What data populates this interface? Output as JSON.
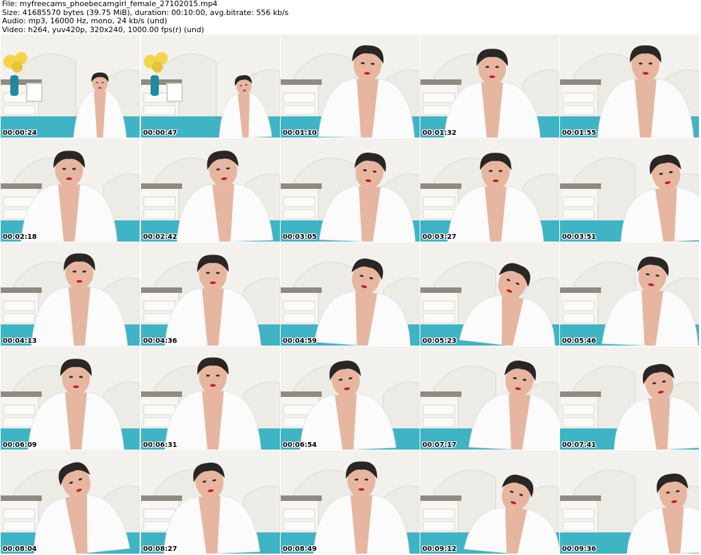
{
  "header": {
    "file_line": "File: myfreecams_phoebecamgirl_female_27102015.mp4",
    "size_line": "Size: 41685570 bytes (39.75 MiB), duration: 00:10:00, avg.bitrate: 556 kb/s",
    "audio_line": "Audio: mp3, 16000 Hz, mono, 24 kb/s (und)",
    "video_line": "Video: h264, yuv420p, 320x240, 1000.00 fps(r) (und)"
  },
  "thumbnails": [
    {
      "timestamp": "00:00:24"
    },
    {
      "timestamp": "00:00:47"
    },
    {
      "timestamp": "00:01:10"
    },
    {
      "timestamp": "00:01:32"
    },
    {
      "timestamp": "00:01:55"
    },
    {
      "timestamp": "00:02:18"
    },
    {
      "timestamp": "00:02:42"
    },
    {
      "timestamp": "00:03:05"
    },
    {
      "timestamp": "00:03:27"
    },
    {
      "timestamp": "00:03:51"
    },
    {
      "timestamp": "00:04:13"
    },
    {
      "timestamp": "00:04:36"
    },
    {
      "timestamp": "00:04:59"
    },
    {
      "timestamp": "00:05:23"
    },
    {
      "timestamp": "00:05:46"
    },
    {
      "timestamp": "00:06:09"
    },
    {
      "timestamp": "00:06:31"
    },
    {
      "timestamp": "00:06:54"
    },
    {
      "timestamp": "00:07:17"
    },
    {
      "timestamp": "00:07:41"
    },
    {
      "timestamp": "00:08:04"
    },
    {
      "timestamp": "00:08:27"
    },
    {
      "timestamp": "00:08:49"
    },
    {
      "timestamp": "00:09:12"
    },
    {
      "timestamp": "00:09:36"
    }
  ],
  "colors": {
    "wall": "#f2f1ed",
    "furniture": "#ecebe5",
    "bed_teal": "#3fb4c4",
    "hair": "#2a2624",
    "skin": "#e6b6a0",
    "shirt": "#fbfbfb",
    "lips": "#c81a24",
    "flowers": "#f3d54a",
    "vase": "#1f8aa0"
  }
}
